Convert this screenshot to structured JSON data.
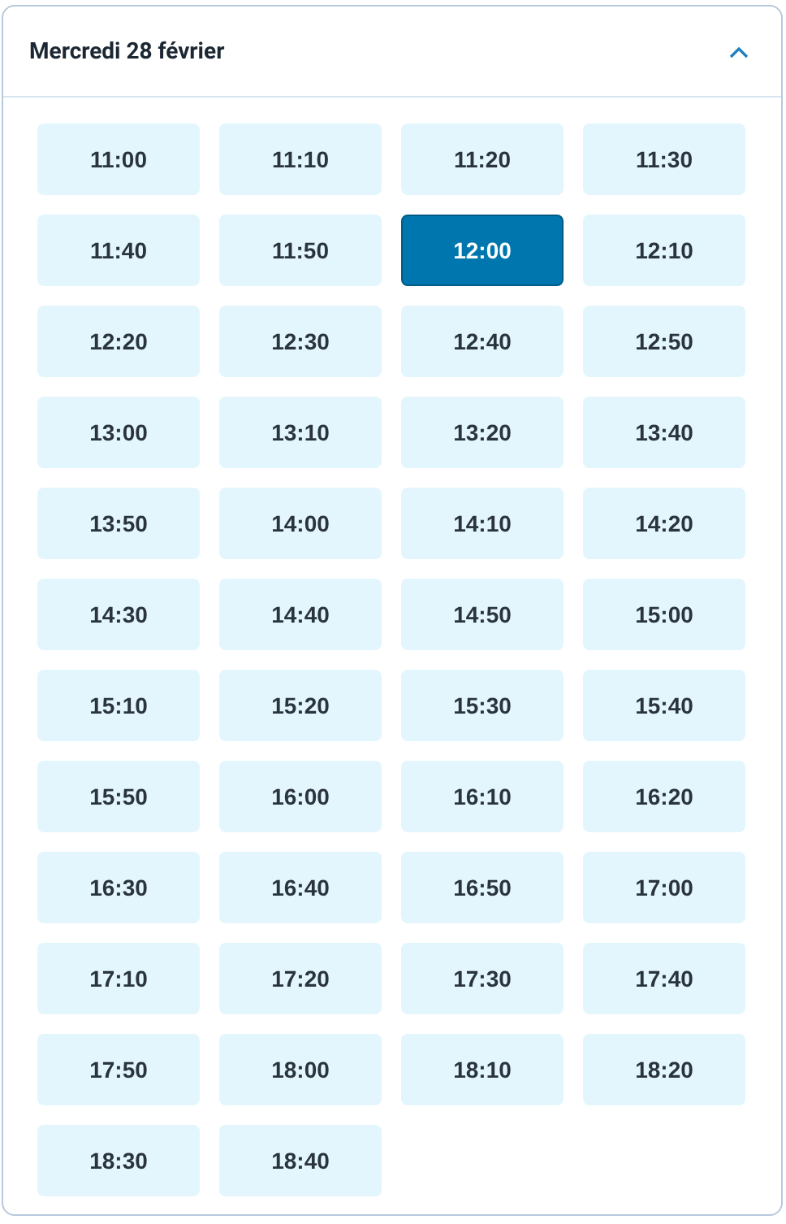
{
  "day": {
    "title": "Mercredi 28 février",
    "expanded": true
  },
  "slots": [
    {
      "label": "11:00",
      "selected": false
    },
    {
      "label": "11:10",
      "selected": false
    },
    {
      "label": "11:20",
      "selected": false
    },
    {
      "label": "11:30",
      "selected": false
    },
    {
      "label": "11:40",
      "selected": false
    },
    {
      "label": "11:50",
      "selected": false
    },
    {
      "label": "12:00",
      "selected": true
    },
    {
      "label": "12:10",
      "selected": false
    },
    {
      "label": "12:20",
      "selected": false
    },
    {
      "label": "12:30",
      "selected": false
    },
    {
      "label": "12:40",
      "selected": false
    },
    {
      "label": "12:50",
      "selected": false
    },
    {
      "label": "13:00",
      "selected": false
    },
    {
      "label": "13:10",
      "selected": false
    },
    {
      "label": "13:20",
      "selected": false
    },
    {
      "label": "13:40",
      "selected": false
    },
    {
      "label": "13:50",
      "selected": false
    },
    {
      "label": "14:00",
      "selected": false
    },
    {
      "label": "14:10",
      "selected": false
    },
    {
      "label": "14:20",
      "selected": false
    },
    {
      "label": "14:30",
      "selected": false
    },
    {
      "label": "14:40",
      "selected": false
    },
    {
      "label": "14:50",
      "selected": false
    },
    {
      "label": "15:00",
      "selected": false
    },
    {
      "label": "15:10",
      "selected": false
    },
    {
      "label": "15:20",
      "selected": false
    },
    {
      "label": "15:30",
      "selected": false
    },
    {
      "label": "15:40",
      "selected": false
    },
    {
      "label": "15:50",
      "selected": false
    },
    {
      "label": "16:00",
      "selected": false
    },
    {
      "label": "16:10",
      "selected": false
    },
    {
      "label": "16:20",
      "selected": false
    },
    {
      "label": "16:30",
      "selected": false
    },
    {
      "label": "16:40",
      "selected": false
    },
    {
      "label": "16:50",
      "selected": false
    },
    {
      "label": "17:00",
      "selected": false
    },
    {
      "label": "17:10",
      "selected": false
    },
    {
      "label": "17:20",
      "selected": false
    },
    {
      "label": "17:30",
      "selected": false
    },
    {
      "label": "17:40",
      "selected": false
    },
    {
      "label": "17:50",
      "selected": false
    },
    {
      "label": "18:00",
      "selected": false
    },
    {
      "label": "18:10",
      "selected": false
    },
    {
      "label": "18:20",
      "selected": false
    },
    {
      "label": "18:30",
      "selected": false
    },
    {
      "label": "18:40",
      "selected": false
    }
  ]
}
